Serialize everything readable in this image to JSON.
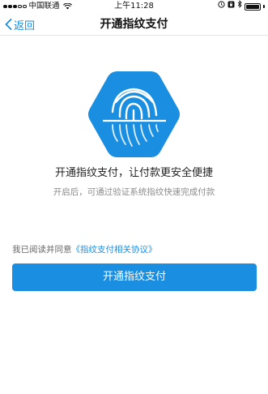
{
  "status_bar": {
    "carrier": "中国联通",
    "time": "上午11:28",
    "signal_bars_filled": 3,
    "signal_bars_total": 5
  },
  "nav": {
    "back_label": "返回",
    "title": "开通指纹支付"
  },
  "hero": {
    "icon": "fingerprint-icon",
    "color": "#1a8ee0"
  },
  "content": {
    "headline": "开通指纹支付，让付款更安全便捷",
    "subline": "开启后，可通过验证系统指纹快速完成付款"
  },
  "agreement": {
    "prefix": "我已阅读并同意",
    "link_text": "《指纹支付相关协议》"
  },
  "primary_button": {
    "label": "开通指纹支付"
  },
  "colors": {
    "accent": "#1a8ee0",
    "text_primary": "#222222",
    "text_secondary": "#8c8c8c"
  }
}
